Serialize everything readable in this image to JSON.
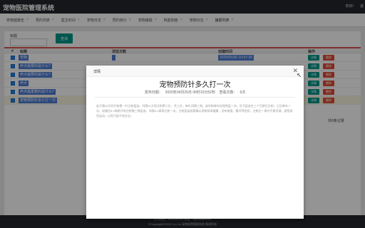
{
  "app": {
    "title": "宠物医院管理系统",
    "user": "你好!",
    "user2": "退"
  },
  "tabs": [
    {
      "label": "宠物健康史"
    },
    {
      "label": "预约列表"
    },
    {
      "label": "医生时间"
    },
    {
      "label": "宠物日志"
    },
    {
      "label": "预约统计"
    },
    {
      "label": "宠物播报"
    },
    {
      "label": "档案制度"
    },
    {
      "label": "宠物日志"
    },
    {
      "label": "播报列表"
    }
  ],
  "search": {
    "label": "标题",
    "button": "查询"
  },
  "table": {
    "headers": {
      "num": "#",
      "title": "标题",
      "views": "浏览次数",
      "time": "创建时间",
      "ops": "操作"
    },
    "rows": [
      {
        "title": "宠物",
        "views": "",
        "time": "2020/05/30 10:37:30"
      },
      {
        "title": "养犬最要的是什么?",
        "views": "",
        "time": ""
      },
      {
        "title": "养犬最要的是什么?",
        "views": "",
        "time": ""
      },
      {
        "title": "养犬",
        "views": "",
        "time": ""
      },
      {
        "title": "养犬最重要的是什么?",
        "views": "",
        "time": ""
      },
      {
        "title": "宠物预防针多久打一次",
        "views": "",
        "time": ""
      }
    ],
    "detail_label": "详情",
    "delete_label": "删除"
  },
  "pager": {
    "text": "共6条记录"
  },
  "dialog": {
    "header": "详情",
    "close": "✕",
    "title": "宠物预防针多久打一次",
    "date_label": "发布日期：",
    "date": "2020年04月26日 06时10分52秒",
    "views_label": "查看次数：",
    "views": "6次",
    "body": "幼犬满45天时开始第一针注射疫苗，间隔21天再注射第二针，共三针。每针间隔三周。成年狗每年加强免疫一次。狂犬疫苗在三个月龄后注射，之后每年一次。幼猫在8-9周龄开始注射猫三联疫苗，间隔3-4周再注射一次。注射疫苗前要确认宠物身体健康，没有感冒、腹泻等症状。注射后一周内不要洗澡，避免剧烈运动，以免引起不良反应。"
  },
  "footer": {
    "line1": "公司地址：XXXXXXXX 电话：088-88889999",
    "line2": "©Copyright©2020 Co.,Ltd 宠物医院管理系统 版权所有"
  }
}
